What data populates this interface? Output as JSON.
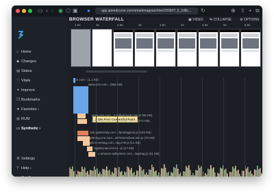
{
  "browser": {
    "url": "app.speedcurve.com/smartimagearchive/20060?_fi_2d8c..."
  },
  "sidebar": {
    "items": [
      {
        "label": "Home",
        "icon": "home-icon",
        "glyph": "⌂"
      },
      {
        "label": "Changes",
        "icon": "changes-icon",
        "glyph": "◆"
      },
      {
        "label": "Status",
        "icon": "status-icon",
        "glyph": "▤"
      },
      {
        "label": "Vitals",
        "icon": "vitals-icon",
        "glyph": "♡"
      },
      {
        "label": "Improve",
        "icon": "improve-icon",
        "glyph": "✦"
      },
      {
        "label": "Bookmarks",
        "icon": "bookmark-icon",
        "glyph": "❐"
      },
      {
        "label": "Favorites ›",
        "icon": "star-icon",
        "glyph": "★"
      },
      {
        "label": "RUM",
        "icon": "rum-icon",
        "glyph": "◍"
      },
      {
        "label": "Synthetic ›",
        "icon": "synthetic-icon",
        "glyph": "▭"
      }
    ],
    "bottom": [
      {
        "label": "Settings",
        "icon": "gear-icon",
        "glyph": "⚙"
      },
      {
        "label": "Help ›",
        "icon": "help-icon",
        "glyph": "?"
      },
      {
        "label": "Geoff ›",
        "icon": "user-icon",
        "glyph": "●"
      }
    ]
  },
  "waterfall": {
    "title": "BROWSER WATERFALL",
    "tools": [
      "VIDEO",
      "COLLAPSE",
      "OPTIONS"
    ],
    "ticks": [
      "1.5s",
      "2s",
      "2.5s",
      "3s",
      "3.5s",
      "4s",
      "4.5s",
      "5s",
      "5.5s"
    ],
    "fcp_label": "2.18s First Contentful Paint",
    "requests": [
      "cnn.com - (1.1 Kb)",
      "www.cnn.com - (865 KB)",
      "www.cnn.com.../r-adfuel-body.min.js (95 KB)",
      "www.cnn.com...cnn-adfuel.min.js (272 KB)",
      "cdn.optimizely.com.../landingpros.js (102 KB)",
      "lightning.cnn.com...2978c87af1e5.min.js (70 KB)",
      "get.s-onetag.com...tag.min.js (11 KB)",
      "registry.api.cnn.io...js (17 KB)",
      "c.amazon-adsystem.com.../apstag.js (61 KB)"
    ],
    "colors": {
      "html": "#6aa4e8",
      "js": "#f3c89e",
      "css": "#b57be0",
      "image": "#8fcf8a"
    }
  }
}
